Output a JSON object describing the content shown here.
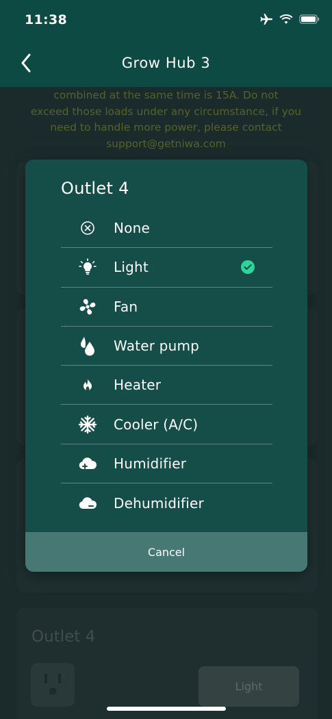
{
  "status_bar": {
    "time": "11:38"
  },
  "nav": {
    "title": "Grow Hub 3"
  },
  "notice": {
    "lines": [
      "combined at the same time is 15A. Do not",
      "exceed those loads under any circumstance, if you",
      "need to handle more power, please contact",
      "support@getniwa.com"
    ]
  },
  "background": {
    "outlet_title": "Outlet 4",
    "device_button_label": "Light"
  },
  "modal": {
    "title": "Outlet 4",
    "selected_index": 1,
    "accent_color": "#2ed59a",
    "options": [
      {
        "label": "None",
        "icon": "none-circle-x-icon"
      },
      {
        "label": "Light",
        "icon": "light-bulb-icon"
      },
      {
        "label": "Fan",
        "icon": "fan-icon"
      },
      {
        "label": "Water pump",
        "icon": "water-drops-icon"
      },
      {
        "label": "Heater",
        "icon": "flame-icon"
      },
      {
        "label": "Cooler (A/C)",
        "icon": "snowflake-icon"
      },
      {
        "label": "Humidifier",
        "icon": "cloud-plus-icon"
      },
      {
        "label": "Dehumidifier",
        "icon": "cloud-minus-icon"
      }
    ],
    "cancel_label": "Cancel"
  }
}
